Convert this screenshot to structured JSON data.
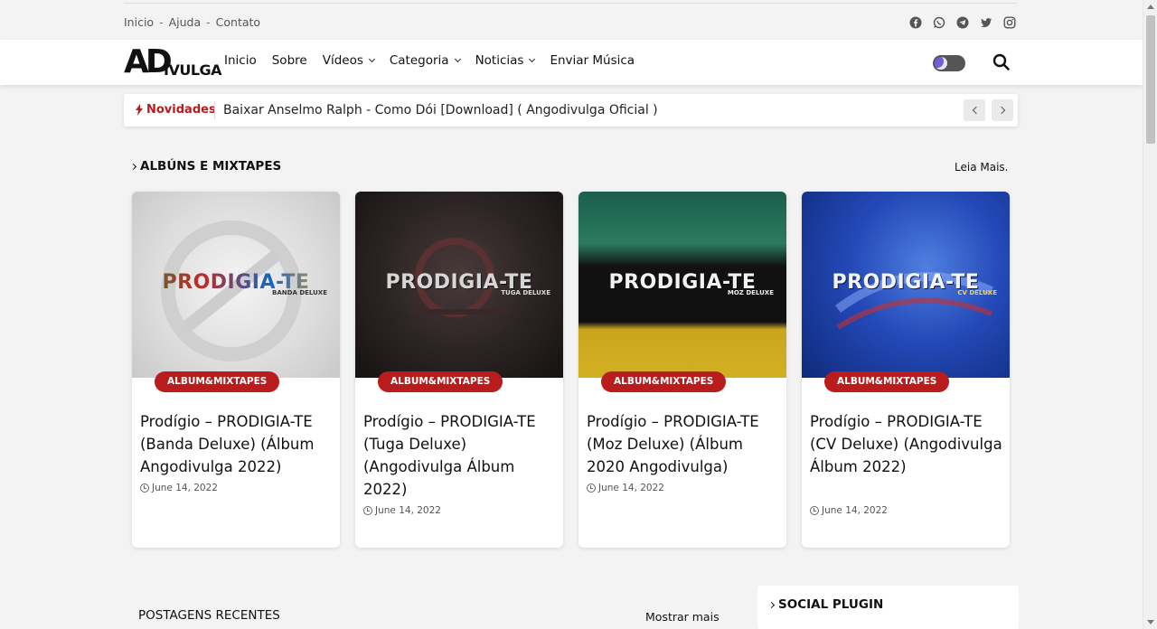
{
  "topbar": {
    "links": [
      "Inicio",
      "Ajuda",
      "Contato"
    ],
    "separator": "-",
    "socials": [
      "facebook-icon",
      "whatsapp-icon",
      "telegram-icon",
      "twitter-icon",
      "instagram-icon"
    ]
  },
  "logo": {
    "main": "AD",
    "sub": "IVULGA"
  },
  "nav": {
    "items": [
      {
        "label": "Inicio",
        "dropdown": false
      },
      {
        "label": "Sobre",
        "dropdown": false
      },
      {
        "label": "Vídeos",
        "dropdown": true
      },
      {
        "label": "Categoria",
        "dropdown": true
      },
      {
        "label": "Noticias",
        "dropdown": true
      },
      {
        "label": "Enviar Música",
        "dropdown": false
      }
    ]
  },
  "ticker": {
    "label": "Novidades",
    "text": "Baixar Anselmo Ralph - Como Dói [Download] ( Angodivulga Oficial )"
  },
  "albums": {
    "title": "ALBÚNS E MIXTAPES",
    "read_more": "Leia Mais.",
    "cards": [
      {
        "cover_text": "PRODIGIA-TE",
        "cover_sub": "BANDA DELUXE",
        "badge": "ALBUM&MIXTAPES",
        "title": "Prodígio – PRODIGIA-TE (Banda Deluxe) (Álbum Angodivulga 2022)",
        "date": "June 14, 2022"
      },
      {
        "cover_text": "PRODIGIA-TE",
        "cover_sub": "TUGA DELUXE",
        "badge": "ALBUM&MIXTAPES",
        "title": "Prodígio – PRODIGIA-TE (Tuga Deluxe) (Angodivulga Álbum 2022)",
        "date": "June 14, 2022"
      },
      {
        "cover_text": "PRODIGIA-TE",
        "cover_sub": "MOZ DELUXE",
        "badge": "ALBUM&MIXTAPES",
        "title": "Prodígio – PRODIGIA-TE (Moz Deluxe) (Álbum 2020 Angodivulga)",
        "date": "June 14, 2022"
      },
      {
        "cover_text": "PRODIGIA-TE",
        "cover_sub": "CV DELUXE",
        "badge": "ALBUM&MIXTAPES",
        "title": "Prodígio – PRODIGIA-TE (CV Deluxe) (Angodivulga Álbum 2022)",
        "date": "June 14, 2022"
      }
    ]
  },
  "recent": {
    "title": "POSTAGENS RECENTES",
    "show_more": "Mostrar mais"
  },
  "social_plugin": {
    "title": "SOCIAL PLUGIN"
  },
  "colors": {
    "accent": "#b81c1c",
    "background": "#f3f3f3"
  }
}
